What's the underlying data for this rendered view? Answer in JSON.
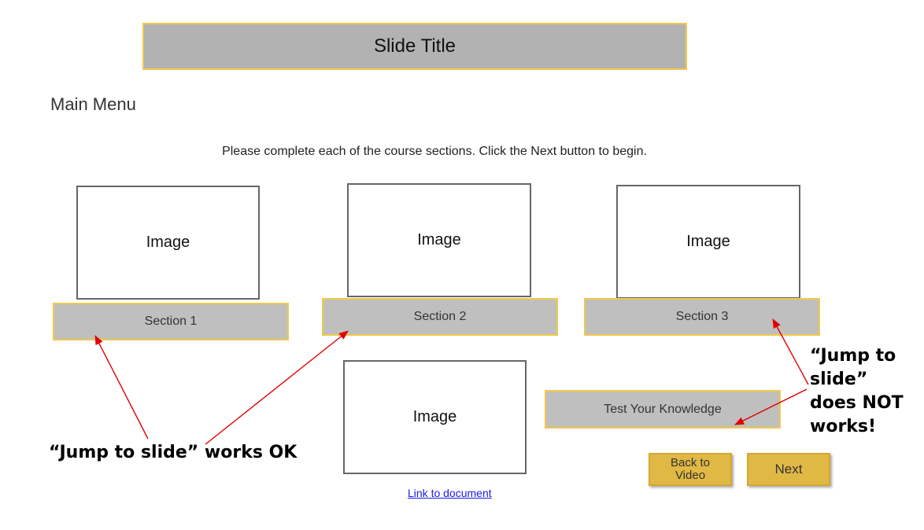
{
  "slide": {
    "title": "Slide Title",
    "menu_title": "Main Menu",
    "instructions": "Please complete each of the course sections. Click the Next button to begin."
  },
  "images": [
    "Image",
    "Image",
    "Image",
    "Image"
  ],
  "sections": [
    "Section 1",
    "Section 2",
    "Section 3"
  ],
  "test_button": "Test Your Knowledge",
  "nav": {
    "back_label": "Back to Video",
    "next_label": "Next"
  },
  "link_label": "Link to document",
  "annotations": {
    "works": "“Jump to slide” works OK",
    "not_works_lines": [
      "“Jump to",
      "slide”",
      "does NOT",
      "works!"
    ]
  },
  "colors": {
    "title_bar": "#b2b2b2",
    "border_gold": "#f0c94b",
    "button_gold": "#e0b844",
    "arrow": "#e00000",
    "link": "#1a1ae6"
  }
}
